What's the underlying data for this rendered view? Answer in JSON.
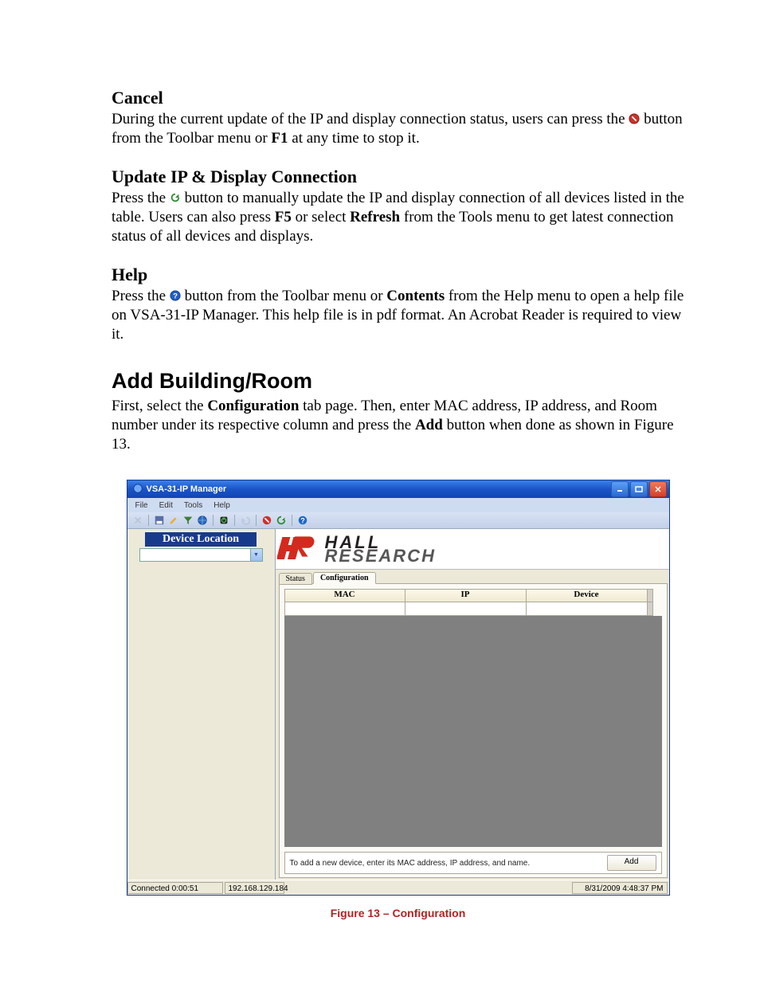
{
  "doc": {
    "sections": {
      "cancel": {
        "heading": "Cancel",
        "body_pre": "During the current update of the IP and display connection status, users can press the ",
        "body_post": " button from the Toolbar menu or ",
        "f1": "F1",
        "body_end": " at any time to stop it."
      },
      "update": {
        "heading": "Update IP & Display Connection",
        "body_pre": "Press the ",
        "body_mid": " button to manually update the IP and display connection of all devices listed in the table.  Users can also press ",
        "f5": "F5",
        "body_mid2": " or select ",
        "refresh": "Refresh",
        "body_end": " from the Tools menu to get latest connection status of all devices and displays."
      },
      "help": {
        "heading": "Help",
        "body_pre": "Press the ",
        "body_mid": " button from the Toolbar menu or ",
        "contents": "Contents",
        "body_end": " from the Help menu to open a help file on VSA-31-IP Manager.  This help file is in pdf format.  An Acrobat Reader is required to view it."
      },
      "addroom": {
        "heading": "Add Building/Room",
        "body_pre": "First, select the ",
        "config": "Configuration",
        "body_mid": " tab page.  Then, enter MAC address, IP address, and Room number under its respective column and press the ",
        "add": "Add",
        "body_end": " button when done as shown in Figure 13."
      }
    },
    "figure_caption": "Figure 13 – Configuration"
  },
  "window": {
    "title": "VSA-31-IP Manager",
    "menus": {
      "file": "File",
      "edit": "Edit",
      "tools": "Tools",
      "help": "Help"
    },
    "sidebar": {
      "header": "Device Location"
    },
    "logo": {
      "line1": "HALL",
      "line2": "RESEARCH"
    },
    "tabs": {
      "status": "Status",
      "config": "Configuration"
    },
    "grid": {
      "mac": "MAC",
      "ip": "IP",
      "device": "Device"
    },
    "bottom_hint": "To add a new device, enter its MAC address, IP address, and name.",
    "add_button": "Add",
    "status": {
      "connected": "Connected  0:00:51",
      "ip": "192.168.129.184",
      "datetime": "8/31/2009 4:48:37 PM"
    }
  }
}
